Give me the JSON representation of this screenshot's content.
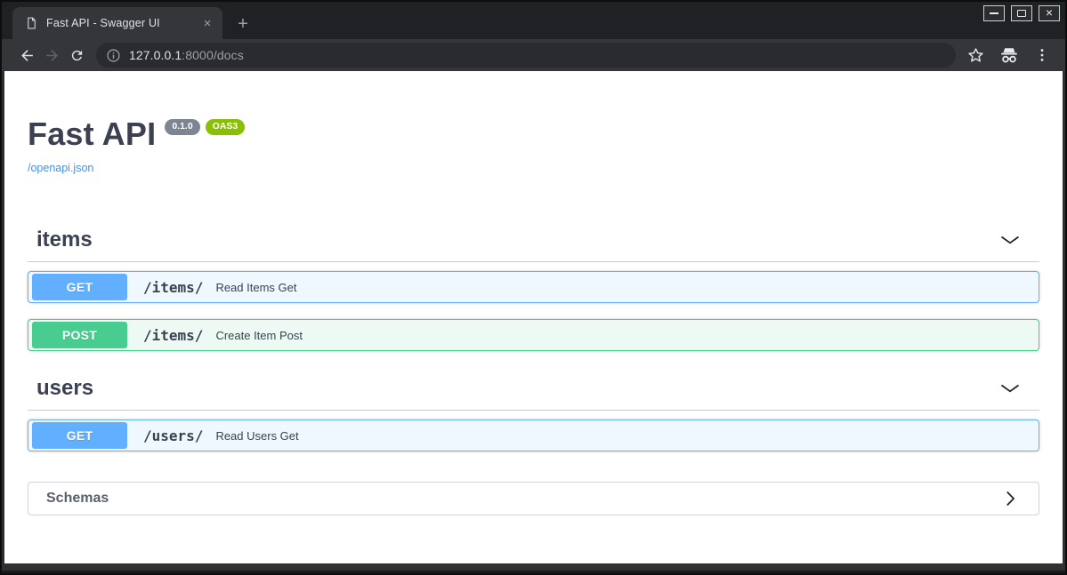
{
  "window": {
    "tab": {
      "title": "Fast API - Swagger UI",
      "close_glyph": "×",
      "new_tab_glyph": "+"
    },
    "controls": {
      "minimize": "minimize",
      "maximize": "maximize",
      "close": "close",
      "close_glyph": "×"
    }
  },
  "address_bar": {
    "host": "127.0.0.1",
    "rest": ":8000/docs"
  },
  "toolbar_icons": [
    "back-arrow",
    "forward-arrow",
    "reload",
    "site-info",
    "bookmark-star",
    "incognito-badge",
    "three-dot-menu"
  ],
  "api": {
    "title": "Fast API",
    "version_badge": "0.1.0",
    "oas_badge": "OAS3",
    "spec_link": "/openapi.json",
    "sections": [
      {
        "name": "items",
        "operations": [
          {
            "method": "GET",
            "path": "/items/",
            "summary": "Read Items Get"
          },
          {
            "method": "POST",
            "path": "/items/",
            "summary": "Create Item Post"
          }
        ]
      },
      {
        "name": "users",
        "operations": [
          {
            "method": "GET",
            "path": "/users/",
            "summary": "Read Users Get"
          }
        ]
      }
    ],
    "schemas_label": "Schemas"
  },
  "colors": {
    "get": "#61affe",
    "post": "#49cc90",
    "link": "#4990e2",
    "version_badge": "#7d8492",
    "oas_badge": "#89bf04",
    "heading_text": "#3b4151",
    "toolbar_bg": "#35363a",
    "titlebar_bg": "#202124"
  }
}
